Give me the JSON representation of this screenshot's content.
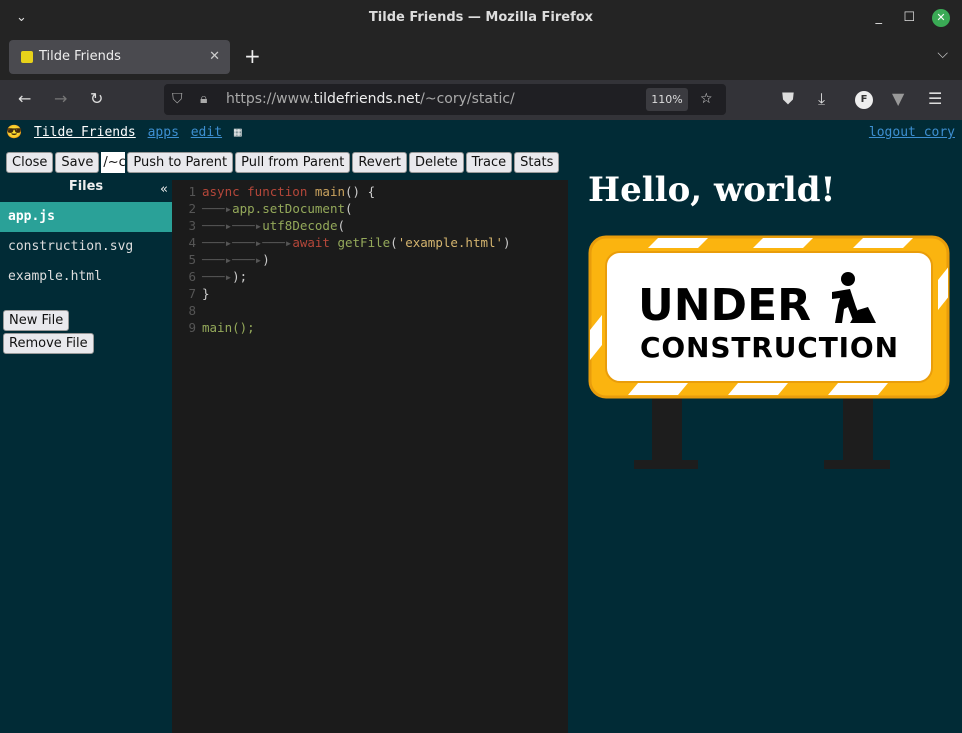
{
  "window": {
    "title": "Tilde Friends — Mozilla Firefox"
  },
  "tabs": [
    {
      "label": "Tilde Friends"
    }
  ],
  "navbar": {
    "url_prefix": "https://www.",
    "url_domain": "tildefriends.net",
    "url_path": "/~cory/static/",
    "zoom": "110%"
  },
  "header": {
    "brand": "Tilde Friends",
    "apps": "apps",
    "edit": "edit",
    "logout": "logout cory"
  },
  "toolbar": {
    "close": "Close",
    "save": "Save",
    "path": "/~cory/static",
    "push": "Push to Parent",
    "pull": "Pull from Parent",
    "revert": "Revert",
    "delete": "Delete",
    "trace": "Trace",
    "stats": "Stats"
  },
  "files": {
    "title": "Files",
    "collapse": "«",
    "items": [
      "app.js",
      "construction.svg",
      "example.html"
    ],
    "selected": "app.js",
    "new_file": "New File",
    "remove_file": "Remove File"
  },
  "editor": {
    "lines": [
      "async function main() {",
      "\tapp.setDocument(",
      "\t\tutf8Decode(",
      "\t\t\tawait getFile('example.html')",
      "\t\t)",
      "\t);",
      "}",
      "",
      "main();"
    ]
  },
  "preview": {
    "heading": "Hello, world!",
    "sign_line1": "UNDER",
    "sign_line2": "CONSTRUCTION"
  },
  "colors": {
    "page_bg": "#012b36",
    "selected_file": "#2aa198",
    "sign_yellow": "#fbb40f"
  }
}
